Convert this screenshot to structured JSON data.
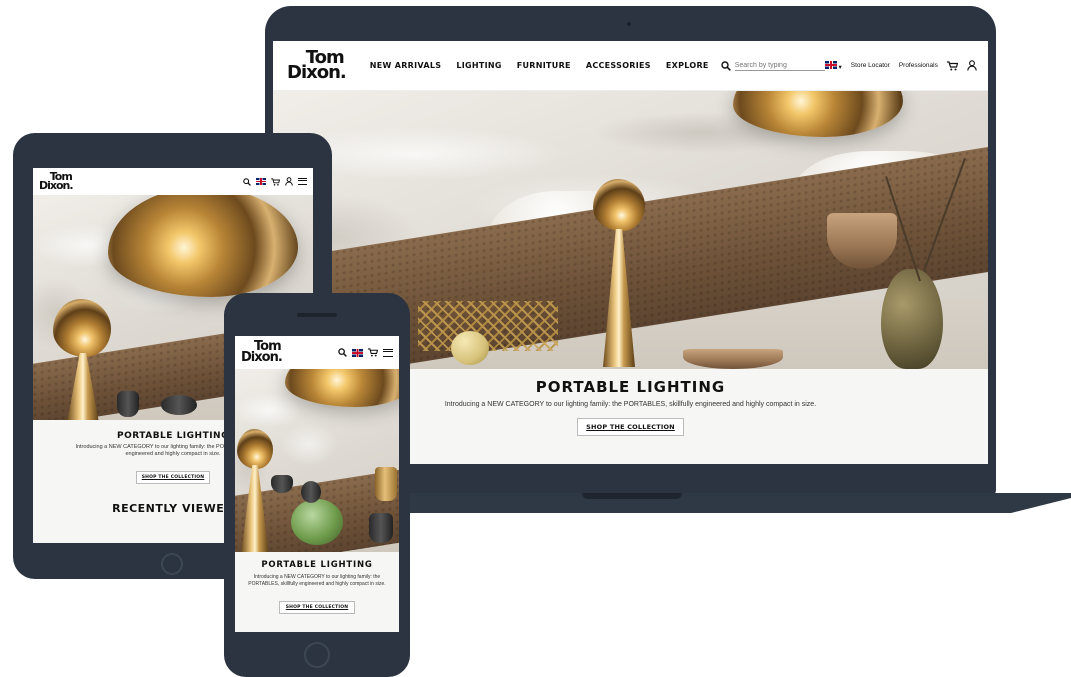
{
  "brand": {
    "logo_line1": "Tom",
    "logo_line2": "Dixon."
  },
  "nav": {
    "items": [
      "NEW ARRIVALS",
      "LIGHTING",
      "FURNITURE",
      "ACCESSORIES",
      "EXPLORE"
    ],
    "search_placeholder": "Search by typing",
    "store_locator": "Store Locator",
    "professionals": "Professionals",
    "lang_caret": "▾"
  },
  "hero": {
    "title": "PORTABLE LIGHTING",
    "intro": "Introducing a NEW CATEGORY to our lighting family: the PORTABLES, skillfully engineered and highly compact in size.",
    "cta": "SHOP THE COLLECTION"
  },
  "tablet": {
    "title": "PORTABLE LIGHTING",
    "intro": "Introducing a NEW CATEGORY to our lighting family: the PORTABLES, skillfully engineered and highly compact in size.",
    "cta": "SHOP THE COLLECTION",
    "recently_viewed": "RECENTLY VIEWED"
  },
  "phone": {
    "title": "PORTABLE LIGHTING",
    "intro": "Introducing a NEW CATEGORY to our lighting family: the PORTABLES, skillfully engineered and highly compact in size.",
    "cta": "SHOP THE COLLECTION"
  },
  "icons": {
    "search": "search-icon",
    "flag": "uk-flag-icon",
    "cart": "cart-icon",
    "account": "account-icon",
    "menu": "hamburger-menu-icon"
  },
  "colors": {
    "device_frame": "#2b3440",
    "accent_gold": "#c9a253",
    "text": "#111111"
  }
}
